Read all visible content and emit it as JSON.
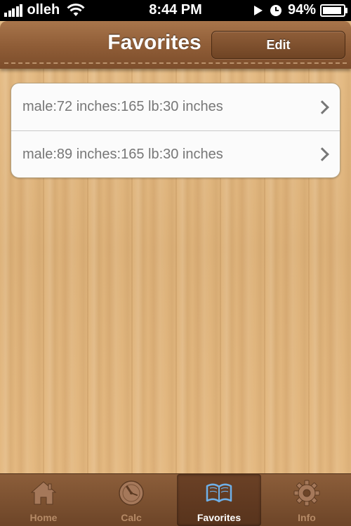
{
  "status_bar": {
    "carrier": "olleh",
    "time": "8:44 PM",
    "battery": "94%",
    "battery_level": 94
  },
  "nav_bar": {
    "title": "Favorites",
    "edit_label": "Edit"
  },
  "favorites": [
    {
      "text": "male:72 inches:165 lb:30 inches"
    },
    {
      "text": "male:89 inches:165 lb:30 inches"
    }
  ],
  "tab_bar": {
    "tabs": [
      {
        "label": "Home",
        "icon": "house-icon"
      },
      {
        "label": "Calc",
        "icon": "clock-icon"
      },
      {
        "label": "Favorites",
        "icon": "open-book-icon",
        "selected": true
      },
      {
        "label": "Info",
        "icon": "gear-icon"
      }
    ]
  },
  "colors": {
    "nav_brown": "#8e5c36",
    "wood": "#e2b77f",
    "selected_icon": "#6fb0e8"
  }
}
